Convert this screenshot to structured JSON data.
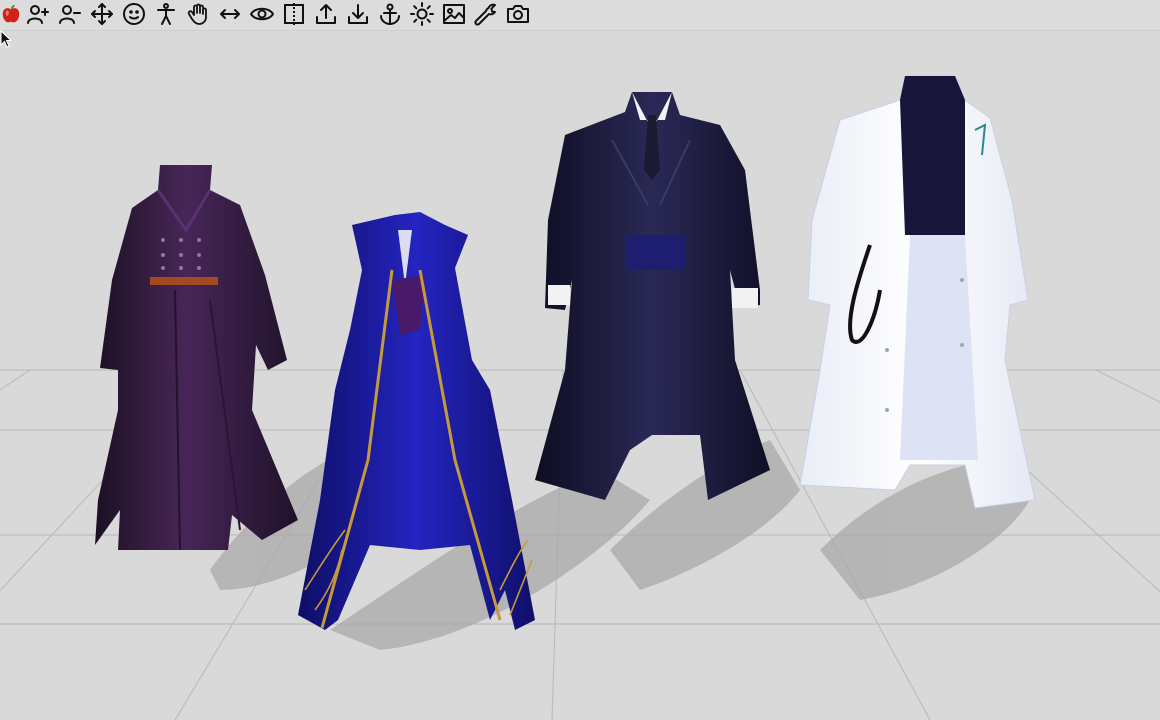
{
  "toolbar": {
    "tools": [
      {
        "icon": "app-apple-icon"
      },
      {
        "icon": "add-avatar-icon"
      },
      {
        "icon": "remove-avatar-icon"
      },
      {
        "icon": "move-icon"
      },
      {
        "icon": "face-icon"
      },
      {
        "icon": "pose-figure-icon"
      },
      {
        "icon": "hand-icon"
      },
      {
        "icon": "horizontal-arrows-icon"
      },
      {
        "icon": "eye-icon"
      },
      {
        "icon": "frame-select-icon"
      },
      {
        "icon": "upload-icon"
      },
      {
        "icon": "download-icon"
      },
      {
        "icon": "anchor-icon"
      },
      {
        "icon": "light-icon"
      },
      {
        "icon": "image-icon"
      },
      {
        "icon": "wrench-icon"
      },
      {
        "icon": "camera-icon"
      }
    ]
  },
  "scene": {
    "background_color": "#d9d9d9",
    "grid_color": "#b8b8b8",
    "shadow_color": "#a8a8a8",
    "garments": [
      {
        "id": "purple-trench-coat",
        "main_color": "#3a1f45",
        "accent_color": "#a24a22"
      },
      {
        "id": "royal-blue-robe",
        "main_color": "#1a1aa0",
        "accent_color": "#c59a3a"
      },
      {
        "id": "dark-navy-suit-coat",
        "main_color": "#1c1b3c",
        "accent_color": "#f2f2f2"
      },
      {
        "id": "white-lab-coat",
        "main_color": "#f4f6fb",
        "accent_color": "#17163a"
      }
    ]
  }
}
